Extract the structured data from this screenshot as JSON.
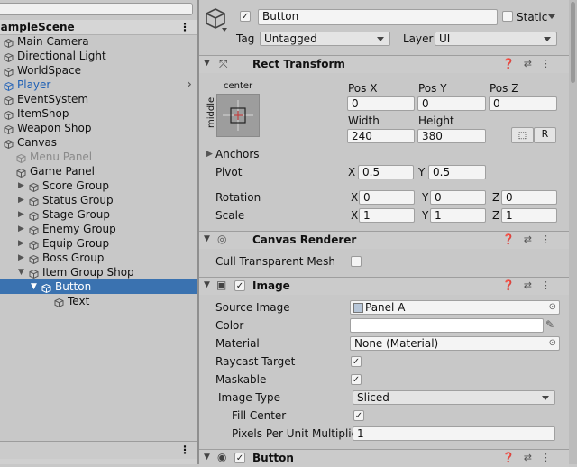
{
  "hierarchy": {
    "scene": "SampleScene",
    "items": [
      {
        "label": "Main Camera",
        "indent": 0,
        "expandable": false,
        "selected": false
      },
      {
        "label": "Directional Light",
        "indent": 0,
        "expandable": false,
        "selected": false
      },
      {
        "label": "WorldSpace",
        "indent": 0,
        "expandable": false,
        "selected": false
      },
      {
        "label": "Player",
        "indent": 0,
        "expandable": false,
        "selected": false,
        "prefab": true
      },
      {
        "label": "EventSystem",
        "indent": 0,
        "expandable": false,
        "selected": false
      },
      {
        "label": "ItemShop",
        "indent": 0,
        "expandable": false,
        "selected": false
      },
      {
        "label": "Weapon Shop",
        "indent": 0,
        "expandable": false,
        "selected": false
      },
      {
        "label": "Canvas",
        "indent": 0,
        "expandable": false,
        "selected": false
      },
      {
        "label": "Menu Panel",
        "indent": 1,
        "expandable": false,
        "selected": false,
        "disabled": true
      },
      {
        "label": "Game Panel",
        "indent": 1,
        "expandable": false,
        "selected": false
      },
      {
        "label": "Score Group",
        "indent": 2,
        "expandable": true,
        "selected": false
      },
      {
        "label": "Status Group",
        "indent": 2,
        "expandable": true,
        "selected": false
      },
      {
        "label": "Stage Group",
        "indent": 2,
        "expandable": true,
        "selected": false
      },
      {
        "label": "Enemy Group",
        "indent": 2,
        "expandable": true,
        "selected": false
      },
      {
        "label": "Equip Group",
        "indent": 2,
        "expandable": true,
        "selected": false
      },
      {
        "label": "Boss Group",
        "indent": 2,
        "expandable": true,
        "selected": false
      },
      {
        "label": "Item Group Shop",
        "indent": 2,
        "expandable": true,
        "expanded": true,
        "selected": false
      },
      {
        "label": "Button",
        "indent": 3,
        "expandable": true,
        "expanded": true,
        "selected": true
      },
      {
        "label": "Text",
        "indent": 4,
        "expandable": false,
        "selected": false
      }
    ]
  },
  "inspector": {
    "name": "Button",
    "static_label": "Static",
    "tag_label": "Tag",
    "tag_value": "Untagged",
    "layer_label": "Layer",
    "layer_value": "UI",
    "rect_transform": {
      "title": "Rect Transform",
      "anchor_top": "center",
      "anchor_side": "middle",
      "pos_x_label": "Pos X",
      "pos_x": "0",
      "pos_y_label": "Pos Y",
      "pos_y": "0",
      "pos_z_label": "Pos Z",
      "pos_z": "0",
      "width_label": "Width",
      "width": "240",
      "height_label": "Height",
      "height": "380",
      "r_button": "R",
      "anchors_label": "Anchors",
      "pivot_label": "Pivot",
      "pivot_x": "0.5",
      "pivot_y": "0.5",
      "rotation_label": "Rotation",
      "rot_x": "0",
      "rot_y": "0",
      "rot_z": "0",
      "scale_label": "Scale",
      "scale_x": "1",
      "scale_y": "1",
      "scale_z": "1",
      "x": "X",
      "y": "Y",
      "z": "Z"
    },
    "canvas_renderer": {
      "title": "Canvas Renderer",
      "cull_label": "Cull Transparent Mesh"
    },
    "image": {
      "title": "Image",
      "source_image_label": "Source Image",
      "source_image": "Panel A",
      "color_label": "Color",
      "material_label": "Material",
      "material": "None (Material)",
      "raycast_label": "Raycast Target",
      "maskable_label": "Maskable",
      "image_type_label": "Image Type",
      "image_type": "Sliced",
      "fill_center_label": "Fill Center",
      "ppu_label": "Pixels Per Unit Multiplie",
      "ppu": "1"
    },
    "button_component": {
      "title": "Button"
    }
  },
  "colors": {
    "selection": "#3a72b0",
    "prefab_text": "#1d5fb4",
    "panel_bg": "#c8c8c8"
  }
}
